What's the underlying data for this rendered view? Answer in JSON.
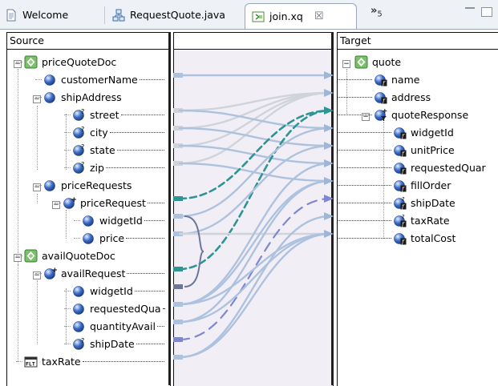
{
  "tabs": [
    {
      "label": "Welcome",
      "icon": "document-icon"
    },
    {
      "label": "RequestQuote.java",
      "icon": "java-class-icon"
    },
    {
      "label": "join.xq",
      "icon": "xquery-file-icon",
      "active": true,
      "close": "☒"
    }
  ],
  "overflow": {
    "glyph": "»",
    "count": "5"
  },
  "panels": {
    "source": "Source",
    "target": "Target"
  },
  "source_tree": [
    {
      "label": "priceQuoteDoc",
      "icon": "document-element-icon"
    },
    {
      "label": "customerName",
      "icon": "element-icon"
    },
    {
      "label": "shipAddress",
      "icon": "element-icon"
    },
    {
      "label": "street",
      "icon": "optional-element-icon"
    },
    {
      "label": "city",
      "icon": "optional-element-icon"
    },
    {
      "label": "state",
      "icon": "optional-element-icon"
    },
    {
      "label": "zip",
      "icon": "optional-element-icon"
    },
    {
      "label": "priceRequests",
      "icon": "element-icon"
    },
    {
      "label": "priceRequest",
      "icon": "repeating-element-icon"
    },
    {
      "label": "widgetId",
      "icon": "element-icon"
    },
    {
      "label": "price",
      "icon": "element-icon"
    },
    {
      "label": "availQuoteDoc",
      "icon": "document-element-icon"
    },
    {
      "label": "availRequest",
      "icon": "repeating-element-icon"
    },
    {
      "label": "widgetId",
      "icon": "element-icon"
    },
    {
      "label": "requestedQua",
      "icon": "element-icon"
    },
    {
      "label": "quantityAvail",
      "icon": "element-icon"
    },
    {
      "label": "shipDate",
      "icon": "optional-element-icon"
    },
    {
      "label": "taxRate",
      "icon": "function-parameter-icon"
    }
  ],
  "target_tree": [
    {
      "label": "quote",
      "icon": "document-element-icon"
    },
    {
      "label": "name",
      "icon": "function-element-icon"
    },
    {
      "label": "address",
      "icon": "function-element-icon"
    },
    {
      "label": "quoteResponse",
      "icon": "repeating-filter-element-icon"
    },
    {
      "label": "widgetId",
      "icon": "function-element-icon"
    },
    {
      "label": "unitPrice",
      "icon": "function-element-icon"
    },
    {
      "label": "requestedQuar",
      "icon": "function-element-icon"
    },
    {
      "label": "fillOrder",
      "icon": "function-element-icon"
    },
    {
      "label": "shipDate",
      "icon": "optional-function-element-icon"
    },
    {
      "label": "taxRate",
      "icon": "optional-function-element-icon"
    },
    {
      "label": "totalCost",
      "icon": "function-element-icon"
    }
  ],
  "colors": {
    "link_solid": "#adc2de",
    "link_gray": "#cfd3da",
    "link_teal": "#2e9494",
    "link_dashblue": "#7f87d1",
    "link_slate": "#6c7796",
    "arrow": "#9fb6d6"
  }
}
